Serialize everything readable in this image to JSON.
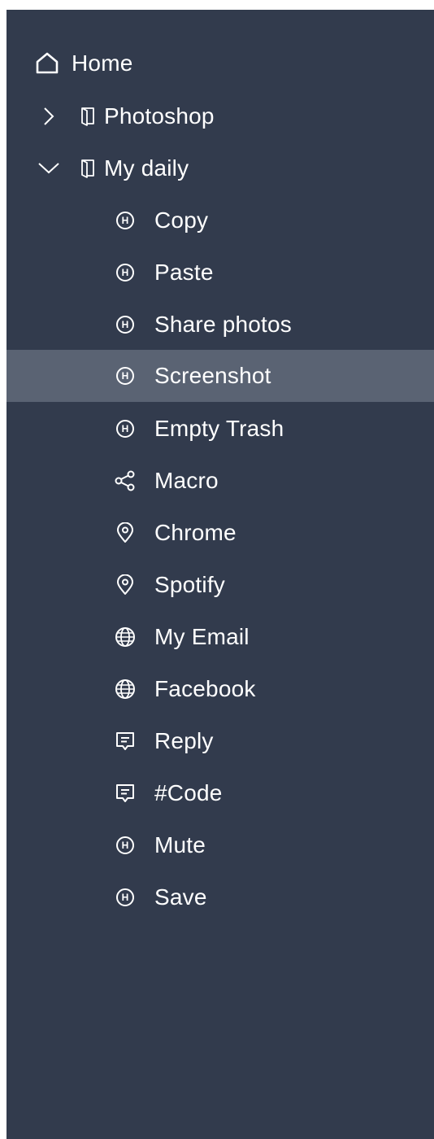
{
  "colors": {
    "sidebar_bg": "#323b4d",
    "selected_bg": "#5a6373",
    "text": "#ffffff"
  },
  "nav": {
    "home": {
      "label": "Home",
      "icon": "home-icon"
    },
    "photoshop": {
      "label": "Photoshop",
      "icon": "book-icon",
      "expanded": false
    },
    "my_daily": {
      "label": "My daily",
      "icon": "book-icon",
      "expanded": true
    },
    "selected_item": "Screenshot",
    "items": [
      {
        "label": "Copy",
        "icon": "hotkey-icon",
        "badge": "H"
      },
      {
        "label": "Paste",
        "icon": "hotkey-icon",
        "badge": "H"
      },
      {
        "label": "Share photos",
        "icon": "hotkey-icon",
        "badge": "H"
      },
      {
        "label": "Screenshot",
        "icon": "hotkey-icon",
        "badge": "H"
      },
      {
        "label": "Empty Trash",
        "icon": "hotkey-icon",
        "badge": "H"
      },
      {
        "label": "Macro",
        "icon": "share-icon"
      },
      {
        "label": "Chrome",
        "icon": "location-pin-icon"
      },
      {
        "label": "Spotify",
        "icon": "location-pin-icon"
      },
      {
        "label": "My Email",
        "icon": "globe-icon"
      },
      {
        "label": "Facebook",
        "icon": "globe-icon"
      },
      {
        "label": "Reply",
        "icon": "message-icon"
      },
      {
        "label": "#Code",
        "icon": "message-icon"
      },
      {
        "label": "Mute",
        "icon": "hotkey-icon",
        "badge": "H"
      },
      {
        "label": "Save",
        "icon": "hotkey-icon",
        "badge": "H"
      }
    ]
  }
}
